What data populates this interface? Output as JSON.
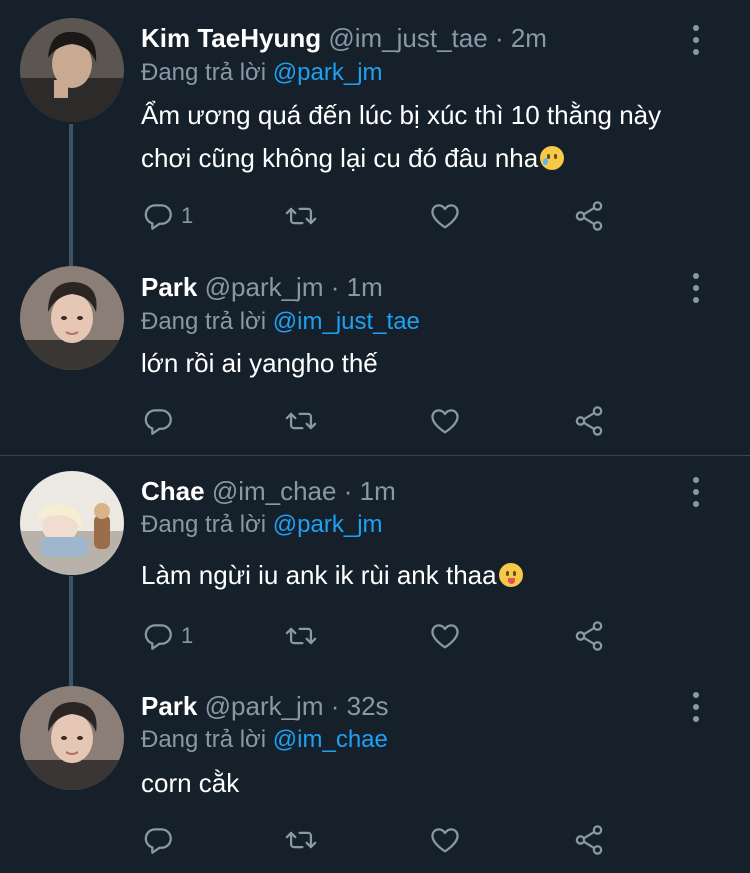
{
  "tweets": [
    {
      "name": "Kim TaeHyung",
      "handle": "@im_just_tae",
      "dot": "·",
      "time": "2m",
      "reply_prefix": "Đang trả lời",
      "reply_to": "@park_jm",
      "text_lines": [
        "Ẩm ương quá đến lúc bị xúc thì 10 thằng này",
        "chơi cũng không lại cu đó đâu nha"
      ],
      "emoji": "smiling-face-with-tear",
      "reply_count": "1",
      "retweet_count": "",
      "like_count": ""
    },
    {
      "name": "Park",
      "handle": "@park_jm",
      "dot": "·",
      "time": "1m",
      "reply_prefix": "Đang trả lời",
      "reply_to": "@im_just_tae",
      "text_lines": [
        "lớn rồi ai yangho thế"
      ],
      "reply_count": "",
      "retweet_count": "",
      "like_count": ""
    },
    {
      "name": "Chae",
      "handle": "@im_chae",
      "dot": "·",
      "time": "1m",
      "reply_prefix": "Đang trả lời",
      "reply_to": "@park_jm",
      "text_lines": [
        "Làm ngừi iu ank ik rùi ank thaa"
      ],
      "emoji": "face-savoring-food",
      "reply_count": "1",
      "retweet_count": "",
      "like_count": ""
    },
    {
      "name": "Park",
      "handle": "@park_jm",
      "dot": "·",
      "time": "32s",
      "reply_prefix": "Đang trả lời",
      "reply_to": "@im_chae",
      "text_lines": [
        "corn cằk"
      ],
      "reply_count": "",
      "retweet_count": "",
      "like_count": ""
    }
  ],
  "icons": {
    "reply": "reply-icon",
    "retweet": "retweet-icon",
    "like": "like-icon",
    "share": "share-icon",
    "more": "more-icon"
  },
  "colors": {
    "background": "#15202b",
    "mention": "#1da1f2",
    "muted": "#8899a6",
    "thread_line": "#3d5466",
    "divider": "#38444d"
  }
}
